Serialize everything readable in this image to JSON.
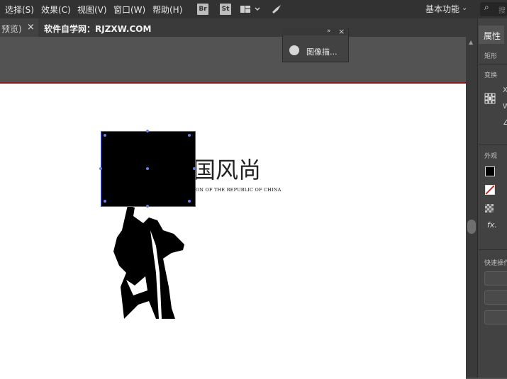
{
  "menu": {
    "items": [
      "选择(S)",
      "效果(C)",
      "视图(V)",
      "窗口(W)",
      "帮助(H)"
    ],
    "bridge_label": "Br",
    "stock_label": "St",
    "workspace": "基本功能",
    "search_placeholder": "搜"
  },
  "tabs": {
    "prev_label": "预览)",
    "close_glyph": "×",
    "active_label": "软件自学网：RJZXW.COM"
  },
  "float_panel": {
    "collapse_glyph": "»",
    "close_glyph": "×",
    "trace_label": "图像描..."
  },
  "artwork": {
    "headline": "国风尚",
    "subline": "ION OF THE REPUBLIC OF CHINA"
  },
  "properties": {
    "tab_label": "属性",
    "section_shape": "矩形",
    "section_transform": "变换",
    "section_appearance": "外观",
    "section_quick_actions": "快速操作",
    "fx_label": "fx."
  },
  "colors": {
    "accent_selection": "#4c5fd5",
    "artboard_top_border": "#8a1a1a"
  }
}
